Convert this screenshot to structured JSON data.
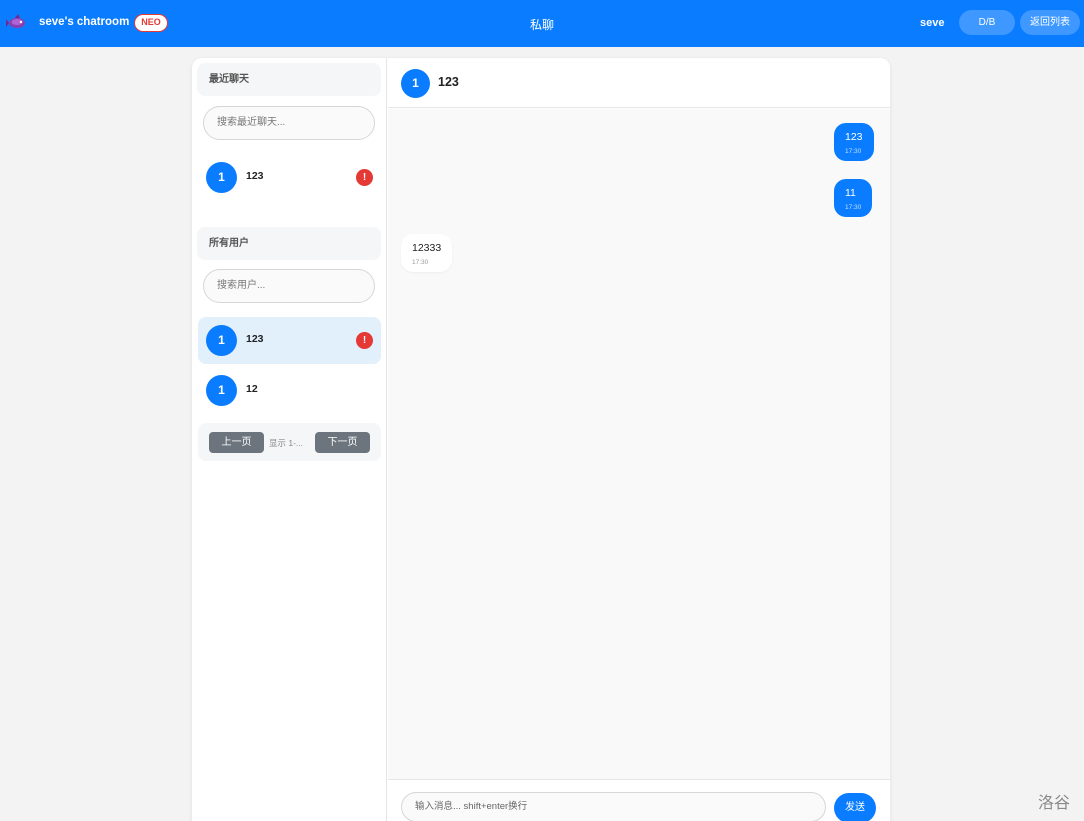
{
  "header": {
    "brand_name": "seve's chatroom",
    "badge": "NEO",
    "title": "私聊",
    "username": "seve",
    "theme_button": "D/B",
    "back_button": "返回列表"
  },
  "sidebar": {
    "recent_title": "最近聊天",
    "recent_search_placeholder": "搜索最近聊天...",
    "recent_chats": [
      {
        "avatar": "1",
        "name": "123",
        "alert": "!"
      }
    ],
    "users_title": "所有用户",
    "users_search_placeholder": "搜索用户...",
    "users": [
      {
        "avatar": "1",
        "name": "123",
        "alert": "!",
        "active": true
      },
      {
        "avatar": "1",
        "name": "12"
      }
    ],
    "pager": {
      "prev": "上一页",
      "info": "显示 1-...",
      "next": "下一页"
    }
  },
  "chat": {
    "avatar": "1",
    "name": "123",
    "messages": [
      {
        "direction": "out",
        "text": "123",
        "time": "17:30"
      },
      {
        "direction": "out",
        "text": "11",
        "time": "17:30"
      },
      {
        "direction": "in",
        "text": "12333",
        "time": "17:30"
      }
    ],
    "input_placeholder": "输入消息... shift+enter换行",
    "send_button": "发送"
  },
  "watermark": "洛谷",
  "colors": {
    "primary": "#0a7cff",
    "alert": "#e53935",
    "pager_button": "#6c757d",
    "active_row": "#e2f0fc"
  },
  "icons": {
    "brand_logo": "purple-fish-logo-icon"
  }
}
